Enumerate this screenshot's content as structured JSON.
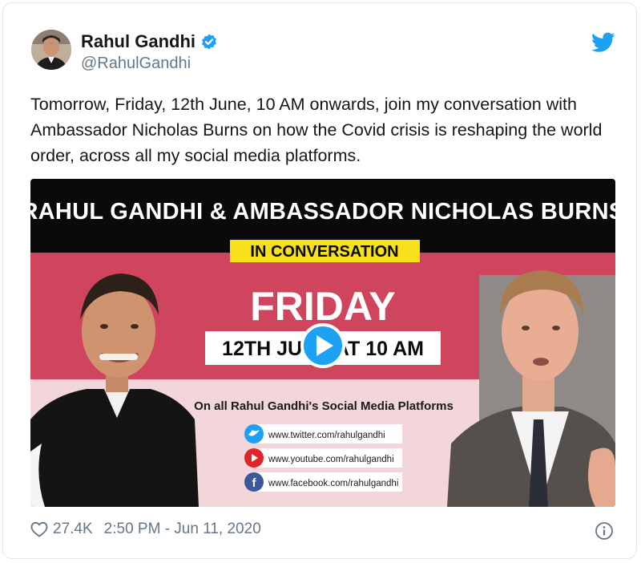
{
  "author": {
    "name": "Rahul Gandhi",
    "handle": "@RahulGandhi",
    "verified": true
  },
  "tweet": {
    "text": "Tomorrow, Friday, 12th June, 10 AM onwards, join my conversation with Ambassador Nicholas Burns on how the Covid crisis is reshaping the world order, across all my social media platforms."
  },
  "media": {
    "headline": "RAHUL GANDHI & AMBASSADOR NICHOLAS BURNS",
    "badge": "IN CONVERSATION",
    "day": "FRIDAY",
    "date_time": "12TH JUNE AT 10 AM",
    "platforms_caption": "On all Rahul Gandhi's Social Media Platforms",
    "links": [
      {
        "icon": "twitter-icon",
        "url": "www.twitter.com/rahulgandhi"
      },
      {
        "icon": "youtube-icon",
        "url": "www.youtube.com/rahulgandhi"
      },
      {
        "icon": "facebook-icon",
        "url": "www.facebook.com/rahulgandhi"
      }
    ]
  },
  "footer": {
    "likes": "27.4K",
    "timestamp": "2:50 PM - Jun 11, 2020"
  },
  "colors": {
    "twitter_blue": "#1da1f2",
    "banner_red": "#d0455e",
    "badge_yellow": "#f7e11a",
    "text_primary": "#14171a",
    "text_secondary": "#657786"
  }
}
